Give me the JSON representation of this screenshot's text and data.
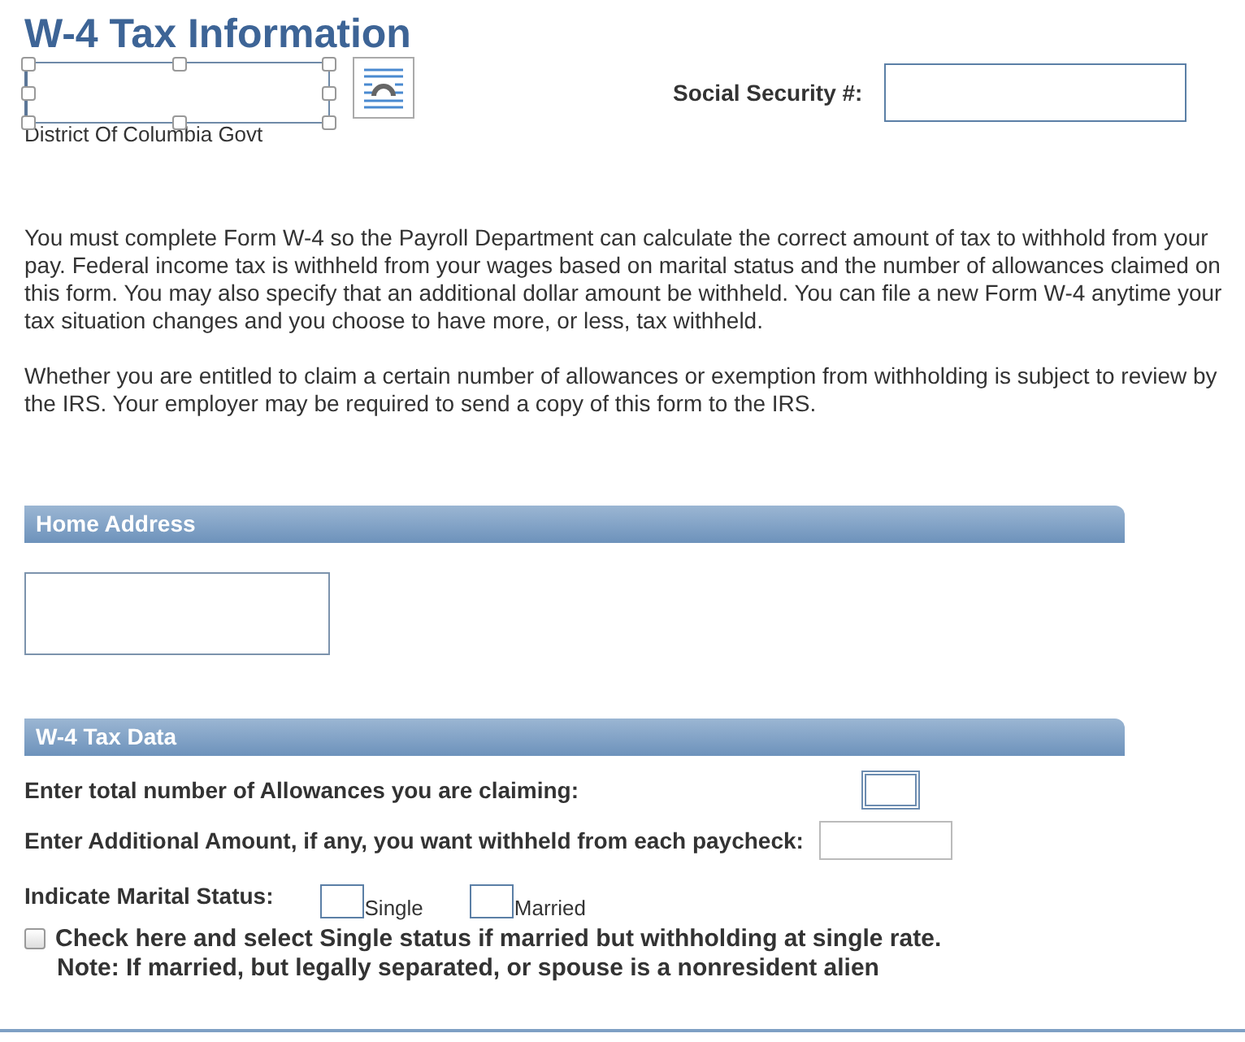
{
  "title": "W-4 Tax Information",
  "logo_caption": "District Of Columbia Govt",
  "ssn": {
    "label": "Social Security #:"
  },
  "paragraphs": [
    "You must complete Form W-4 so the Payroll Department can calculate the correct amount of tax to withhold from your pay.  Federal income tax is withheld from your wages based on marital status and the number of allowances claimed on this form.  You may also specify that an additional dollar amount be withheld.  You can file a new Form W-4 anytime your tax situation changes and you choose to have more, or less, tax withheld.",
    "Whether you are entitled to claim a certain number of allowances or exemption from withholding is subject to review by the IRS.  Your employer may be required to send a copy of this form to the IRS."
  ],
  "home_address": {
    "heading": "Home Address"
  },
  "tax_data": {
    "heading": "W-4 Tax Data",
    "allowances_label": "Enter total number of Allowances you are claiming:",
    "additional_label": "Enter Additional Amount, if any, you want withheld from each paycheck:",
    "marital_label": "Indicate Marital Status:",
    "marital_options": [
      {
        "label": "Single",
        "selected": false
      },
      {
        "label": "Married",
        "selected": false
      }
    ],
    "single_rate": {
      "label": "Check here and select Single status if married but withholding at single rate.",
      "checked": false
    },
    "note": "Note: If married, but legally separated, or spouse is a nonresident alien"
  }
}
